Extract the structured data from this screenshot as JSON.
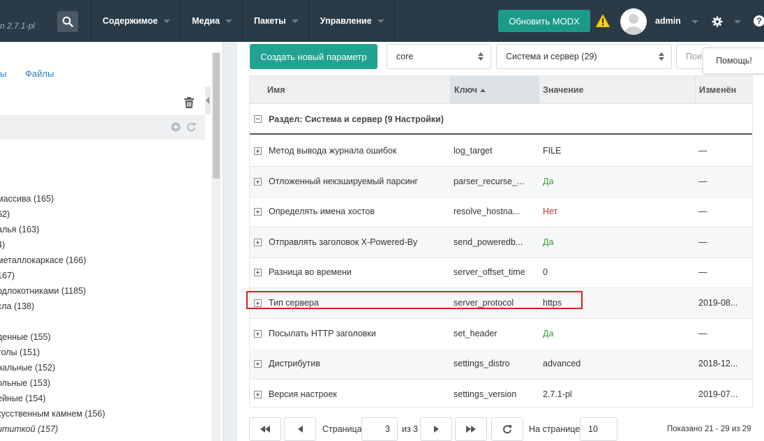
{
  "header": {
    "version": "n 2.7.1-pl",
    "nav": [
      {
        "label": "Содержимое"
      },
      {
        "label": "Медиа"
      },
      {
        "label": "Пакеты"
      },
      {
        "label": "Управление"
      }
    ],
    "update_button": "Обновить MODX",
    "username": "admin",
    "help_glyph": "?",
    "colors": {
      "bar": "#2b3a47",
      "accent": "#1b9a8a",
      "warning": "#f5d40f"
    }
  },
  "left_panel": {
    "tab_partial": "ы",
    "tab_files": "Файлы",
    "tree_items": [
      {
        "text": "массива (165)",
        "italic": false
      },
      {
        "text": "62)",
        "italic": false
      },
      {
        "text": "алья (163)",
        "italic": false
      },
      {
        "text": "4)",
        "italic": false
      },
      {
        "text": "металлокаркасе (166)",
        "italic": false
      },
      {
        "text": "167)",
        "italic": false
      },
      {
        "text": "рдлокотниками (1185)",
        "italic": false
      },
      {
        "text": "сла (138)",
        "italic": false
      },
      {
        "text": "",
        "italic": false
      },
      {
        "text": "денные (155)",
        "italic": false
      },
      {
        "text": "толы (151)",
        "italic": false
      },
      {
        "text": "нальные (152)",
        "italic": false
      },
      {
        "text": "ольные (153)",
        "italic": false
      },
      {
        "text": "ейные (154)",
        "italic": false
      },
      {
        "text": "кусственным камнем (156)",
        "italic": false
      },
      {
        "text": "ититкой (157)",
        "italic": true
      }
    ]
  },
  "toolbar": {
    "create_button": "Создать новый параметр",
    "namespace": "core",
    "area": "Система и сервер (29)",
    "search_partial": "Пои",
    "help_button": "Помощь!"
  },
  "grid": {
    "columns": {
      "name": "Имя",
      "key": "Ключ",
      "value": "Значение",
      "changed": "Изменён"
    },
    "group_label": "Раздел: Система и сервер (9 Настройки)",
    "rows": [
      {
        "name": "Метод вывода журнала ошибок",
        "key": "log_target",
        "value": "FILE",
        "value_type": "plain",
        "changed": "—"
      },
      {
        "name": "Отложенный некэшируемый парсинг",
        "key": "parser_recurse_...",
        "value": "Да",
        "value_type": "yes",
        "changed": "—"
      },
      {
        "name": "Определять имена хостов",
        "key": "resolve_hostna...",
        "value": "Нет",
        "value_type": "no",
        "changed": "—"
      },
      {
        "name": "Отправлять заголовок X-Powered-By",
        "key": "send_poweredb...",
        "value": "Да",
        "value_type": "yes",
        "changed": "—"
      },
      {
        "name": "Разница во времени",
        "key": "server_offset_time",
        "value": "0",
        "value_type": "plain",
        "changed": "—"
      },
      {
        "name": "Тип сервера",
        "key": "server_protocol",
        "value": "https",
        "value_type": "plain",
        "changed": "2019-08..."
      },
      {
        "name": "Посылать HTTP заголовки",
        "key": "set_header",
        "value": "Да",
        "value_type": "yes",
        "changed": "—"
      },
      {
        "name": "Дистрибутив",
        "key": "settings_distro",
        "value": "advanced",
        "value_type": "plain",
        "changed": "2018-12..."
      },
      {
        "name": "Версия настроек",
        "key": "settings_version",
        "value": "2.7.1-pl",
        "value_type": "plain",
        "changed": "2019-07..."
      }
    ],
    "highlighted_row": 5,
    "colors": {
      "yes": "#3a9a3a",
      "no": "#c0392b",
      "highlight": "#d92020"
    }
  },
  "pager": {
    "page_label": "Страница",
    "page_value": "3",
    "of_label": "из 3",
    "per_page_label": "На странице:",
    "per_page_value": "10",
    "summary": "Показано 21 - 29 из 29"
  }
}
